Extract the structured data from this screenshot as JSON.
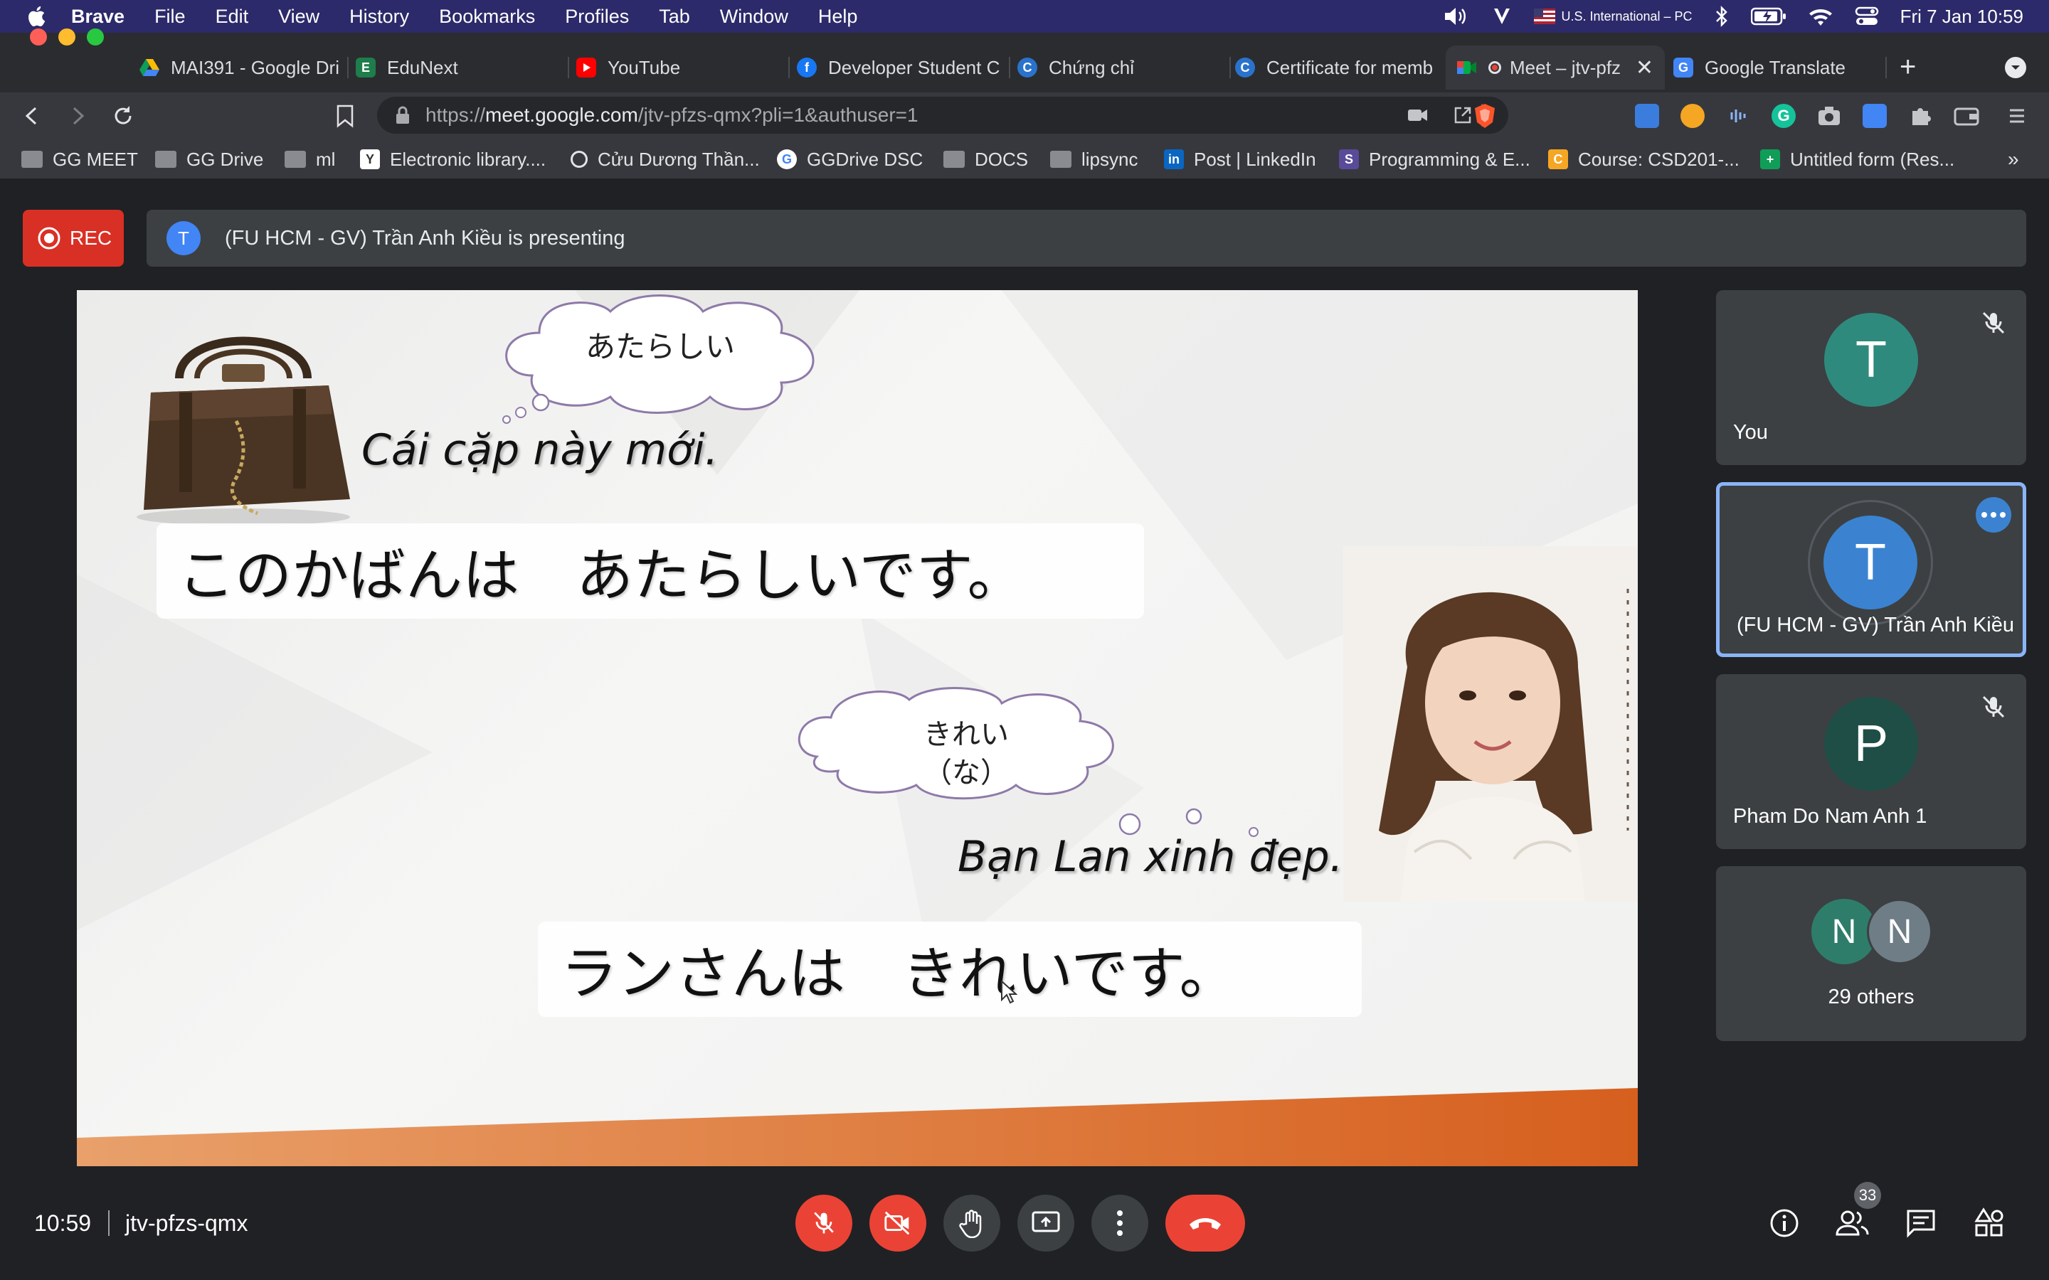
{
  "menubar": {
    "app": "Brave",
    "items": [
      "File",
      "Edit",
      "View",
      "History",
      "Bookmarks",
      "Profiles",
      "Tab",
      "Window",
      "Help"
    ],
    "input_source": "U.S. International – PC",
    "datetime": "Fri 7 Jan  10:59"
  },
  "tabs": [
    {
      "title": "MAI391 - Google Dri",
      "icon": "google-drive-icon"
    },
    {
      "title": "EduNext",
      "icon": "edunext-icon"
    },
    {
      "title": "YouTube",
      "icon": "youtube-icon"
    },
    {
      "title": "Developer Student C",
      "icon": "facebook-icon"
    },
    {
      "title": "Chứng chỉ",
      "icon": "coursera-icon"
    },
    {
      "title": "Certificate for memb",
      "icon": "coursera-icon"
    },
    {
      "title": "Meet – jtv-pfz",
      "icon": "google-meet-icon"
    },
    {
      "title": "Google Translate",
      "icon": "google-translate-icon"
    }
  ],
  "address": {
    "scheme": "https://",
    "host": "meet.google.com",
    "path": "/jtv-pfzs-qmx?pli=1&authuser=1"
  },
  "bookmarks": [
    "GG MEET",
    "GG Drive",
    "ml",
    "Electronic library....",
    "Cửu Dương Thần...",
    "GGDrive DSC",
    "DOCS",
    "lipsync",
    "Post | LinkedIn",
    "Programming & E...",
    "Course: CSD201-...",
    "Untitled form (Res..."
  ],
  "meet": {
    "rec_label": "REC",
    "presenter_initial": "T",
    "presenting_text": "(FU HCM - GV) Trần Anh Kiều is presenting",
    "time": "10:59",
    "meeting_code": "jtv-pfzs-qmx",
    "people_count": "33"
  },
  "slide": {
    "bubble1": "あたらしい",
    "sentence1_vi": "Cái cặp này mới.",
    "sentence1_jp": "このかばんは　あたらしいです。",
    "bubble2_line1": "きれい",
    "bubble2_line2": "（な）",
    "sentence2_vi": "Bạn Lan xinh đẹp.",
    "sentence2_jp": "ランさんは　きれいです。"
  },
  "participants": [
    {
      "initial": "T",
      "name": "You",
      "color": "#2f8a7e",
      "muted": true
    },
    {
      "initial": "T",
      "name": "(FU HCM - GV) Trần Anh Kiều",
      "color": "#3b83d1",
      "muted": false
    },
    {
      "initial": "P",
      "name": "Pham Do Nam Anh 1",
      "color": "#1f4e46",
      "muted": true
    },
    {
      "initials": [
        "N",
        "N"
      ],
      "name": "29 others",
      "colors": [
        "#2e7d6a",
        "#6f7d87"
      ]
    }
  ],
  "colors": {
    "menubar": "#2c2a6a",
    "rec": "#d93025",
    "end_call": "#d93025",
    "active_speaker_border": "#8ab4f8"
  }
}
